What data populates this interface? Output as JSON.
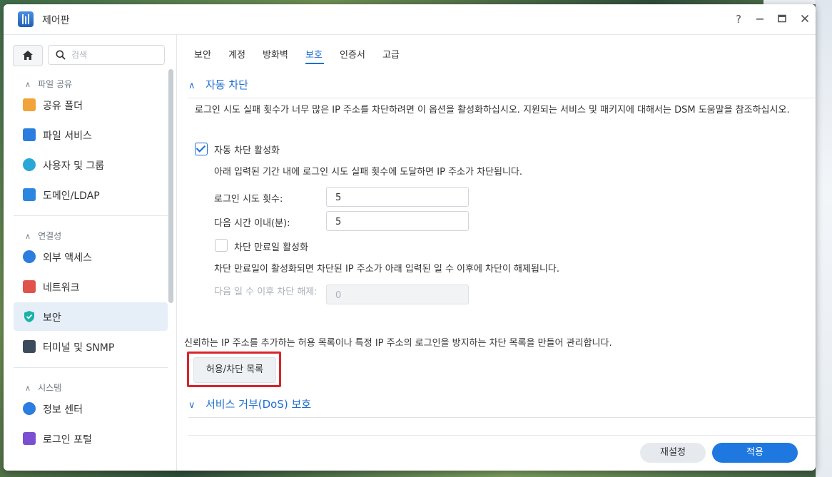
{
  "window": {
    "title": "제어판"
  },
  "sidebar": {
    "search_placeholder": "검색",
    "sections": [
      {
        "title": "파일 공유",
        "items": [
          {
            "label": "공유 폴더",
            "icon": "folder-icon",
            "color": "#f2a33a"
          },
          {
            "label": "파일 서비스",
            "icon": "file-services-icon",
            "color": "#2b7de0"
          },
          {
            "label": "사용자 및 그룹",
            "icon": "users-icon",
            "color": "#29a8d8"
          },
          {
            "label": "도메인/LDAP",
            "icon": "domain-icon",
            "color": "#2b86e0"
          }
        ]
      },
      {
        "title": "연결성",
        "items": [
          {
            "label": "외부 액세스",
            "icon": "external-access-icon",
            "color": "#2b7de0"
          },
          {
            "label": "네트워크",
            "icon": "network-icon",
            "color": "#e0534a"
          },
          {
            "label": "보안",
            "icon": "shield-icon",
            "color": "#18b2a8",
            "active": true
          },
          {
            "label": "터미널 및 SNMP",
            "icon": "terminal-icon",
            "color": "#3b4b5c"
          }
        ]
      },
      {
        "title": "시스템",
        "items": [
          {
            "label": "정보 센터",
            "icon": "info-icon",
            "color": "#2b7de0"
          },
          {
            "label": "로그인 포털",
            "icon": "login-portal-icon",
            "color": "#7a4fd0"
          }
        ]
      }
    ]
  },
  "tabs": [
    {
      "label": "보안"
    },
    {
      "label": "계정"
    },
    {
      "label": "방화벽"
    },
    {
      "label": "보호",
      "active": true
    },
    {
      "label": "인증서"
    },
    {
      "label": "고급"
    }
  ],
  "auto_block": {
    "header": "자동 차단",
    "description": "로그인 시도 실패 횟수가 너무 많은 IP 주소를 차단하려면 이 옵션을 활성화하십시오. 지원되는 서비스 및 패키지에 대해서는 DSM 도움말을 참조하십시오.",
    "enable_label": "자동 차단 활성화",
    "enabled": true,
    "period_note": "아래 입력된 기간 내에 로그인 시도 실패 횟수에 도달하면 IP 주소가 차단됩니다.",
    "attempts_label": "로그인 시도 횟수:",
    "attempts_value": "5",
    "within_label": "다음 시간 이내(분):",
    "within_value": "5",
    "expiration_label": "차단 만료일 활성화",
    "expiration_enabled": false,
    "expiration_note": "차단 만료일이 활성화되면 차단된 IP 주소가 아래 입력된 일 수 이후에 차단이 해제됩니다.",
    "unblock_days_label": "다음 일 수 이후 차단 해제:",
    "unblock_days_value": "0"
  },
  "allow_block": {
    "description": "신뢰하는 IP 주소를 추가하는 허용 목록이나 특정 IP 주소의 로그인을 방지하는 차단 목록을 만들어 관리합니다.",
    "button_label": "허용/차단 목록"
  },
  "dos": {
    "header": "서비스 거부(DoS) 보호"
  },
  "footer": {
    "reset_label": "재설정",
    "apply_label": "적용"
  },
  "colors": {
    "accent": "#1f78e0",
    "highlight": "#d9242b"
  }
}
